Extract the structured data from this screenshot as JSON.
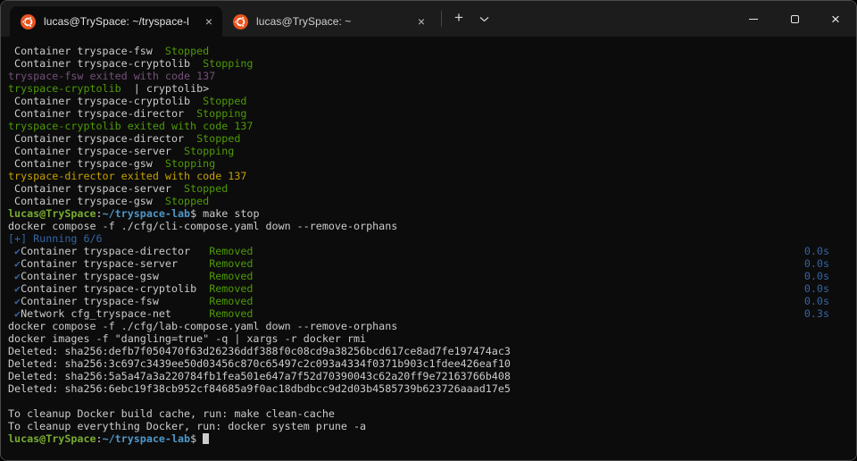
{
  "window": {
    "tabs": [
      {
        "title": "lucas@TrySpace: ~/tryspace-l",
        "active": true
      },
      {
        "title": "lucas@TrySpace: ~",
        "active": false
      }
    ],
    "new_tab_glyph": "+",
    "dropdown_glyph": "⌄",
    "tab_close_glyph": "×",
    "close_glyph": "×"
  },
  "colors": {
    "fg": "#cccccc",
    "green": "#4e9a06",
    "purple": "#75507b",
    "yellow": "#c4a000",
    "blue": "#3465a4",
    "promptUser": "#78ac30",
    "promptPath": "#4e97c9",
    "background": "#0c0c0c",
    "titlebar": "#1c1c1c",
    "ubuntuOrange": "#e95420"
  },
  "terminal": {
    "lines": [
      {
        "s": [
          {
            "t": " Container tryspace-fsw  ",
            "c": "fg"
          },
          {
            "t": "Stopped",
            "c": "green"
          }
        ]
      },
      {
        "s": [
          {
            "t": " Container tryspace-cryptolib  ",
            "c": "fg"
          },
          {
            "t": "Stopping",
            "c": "green"
          }
        ]
      },
      {
        "s": [
          {
            "t": "tryspace-fsw exited with code 137",
            "c": "purple"
          }
        ]
      },
      {
        "s": [
          {
            "t": "tryspace-cryptolib ",
            "c": "green"
          },
          {
            "t": " | cryptolib>",
            "c": "fg"
          }
        ]
      },
      {
        "s": [
          {
            "t": " Container tryspace-cryptolib  ",
            "c": "fg"
          },
          {
            "t": "Stopped",
            "c": "green"
          }
        ]
      },
      {
        "s": [
          {
            "t": " Container tryspace-director  ",
            "c": "fg"
          },
          {
            "t": "Stopping",
            "c": "green"
          }
        ]
      },
      {
        "s": [
          {
            "t": "tryspace-cryptolib exited with code 137",
            "c": "green"
          }
        ]
      },
      {
        "s": [
          {
            "t": " Container tryspace-director  ",
            "c": "fg"
          },
          {
            "t": "Stopped",
            "c": "green"
          }
        ]
      },
      {
        "s": [
          {
            "t": " Container tryspace-server  ",
            "c": "fg"
          },
          {
            "t": "Stopping",
            "c": "green"
          }
        ]
      },
      {
        "s": [
          {
            "t": " Container tryspace-gsw  ",
            "c": "fg"
          },
          {
            "t": "Stopping",
            "c": "green"
          }
        ]
      },
      {
        "s": [
          {
            "t": "tryspace-director exited with code 137",
            "c": "yellow"
          }
        ]
      },
      {
        "s": [
          {
            "t": " Container tryspace-server  ",
            "c": "fg"
          },
          {
            "t": "Stopped",
            "c": "green"
          }
        ]
      },
      {
        "s": [
          {
            "t": " Container tryspace-gsw  ",
            "c": "fg"
          },
          {
            "t": "Stopped",
            "c": "green"
          }
        ]
      },
      {
        "s": [
          {
            "t": "lucas@TrySpace",
            "c": "promptUser",
            "b": true
          },
          {
            "t": ":",
            "c": "fg"
          },
          {
            "t": "~/tryspace-lab",
            "c": "promptPath",
            "b": true
          },
          {
            "t": "$ ",
            "c": "fg"
          },
          {
            "t": "make stop",
            "c": "fg"
          }
        ]
      },
      {
        "s": [
          {
            "t": "docker compose -f ./cfg/cli-compose.yaml down --remove-orphans",
            "c": "fg"
          }
        ]
      },
      {
        "s": [
          {
            "t": "[+] Running 6/6",
            "c": "blue"
          }
        ]
      },
      {
        "s": [
          {
            "t": " ✔",
            "c": "blue"
          },
          {
            "t": "Container tryspace-director   ",
            "c": "fg"
          },
          {
            "t": "Removed",
            "c": "green"
          }
        ],
        "time": "0.0s"
      },
      {
        "s": [
          {
            "t": " ✔",
            "c": "blue"
          },
          {
            "t": "Container tryspace-server     ",
            "c": "fg"
          },
          {
            "t": "Removed",
            "c": "green"
          }
        ],
        "time": "0.0s"
      },
      {
        "s": [
          {
            "t": " ✔",
            "c": "blue"
          },
          {
            "t": "Container tryspace-gsw        ",
            "c": "fg"
          },
          {
            "t": "Removed",
            "c": "green"
          }
        ],
        "time": "0.0s"
      },
      {
        "s": [
          {
            "t": " ✔",
            "c": "blue"
          },
          {
            "t": "Container tryspace-cryptolib  ",
            "c": "fg"
          },
          {
            "t": "Removed",
            "c": "green"
          }
        ],
        "time": "0.0s"
      },
      {
        "s": [
          {
            "t": " ✔",
            "c": "blue"
          },
          {
            "t": "Container tryspace-fsw        ",
            "c": "fg"
          },
          {
            "t": "Removed",
            "c": "green"
          }
        ],
        "time": "0.0s"
      },
      {
        "s": [
          {
            "t": " ✔",
            "c": "blue"
          },
          {
            "t": "Network cfg_tryspace-net      ",
            "c": "fg"
          },
          {
            "t": "Removed",
            "c": "green"
          }
        ],
        "time": "0.3s"
      },
      {
        "s": [
          {
            "t": "docker compose -f ./cfg/lab-compose.yaml down --remove-orphans",
            "c": "fg"
          }
        ]
      },
      {
        "s": [
          {
            "t": "docker images -f \"dangling=true\" -q | xargs -r docker rmi",
            "c": "fg"
          }
        ]
      },
      {
        "s": [
          {
            "t": "Deleted: sha256:defb7f050470f63d26236ddf388f0c08cd9a38256bcd617ce8ad7fe197474ac3",
            "c": "fg"
          }
        ]
      },
      {
        "s": [
          {
            "t": "Deleted: sha256:3c697c3439ee50d03456c870c65497c2c093a4334f0371b903c1fdee426eaf10",
            "c": "fg"
          }
        ]
      },
      {
        "s": [
          {
            "t": "Deleted: sha256:5a5a47a3a220784fb1fea501e647a7f52d70390043c62a20ff9e72163766b408",
            "c": "fg"
          }
        ]
      },
      {
        "s": [
          {
            "t": "Deleted: sha256:6ebc19f38cb952cf84685a9f0ac18dbdbcc9d2d03b4585739b623726aaad17e5",
            "c": "fg"
          }
        ]
      },
      {
        "s": []
      },
      {
        "s": [
          {
            "t": "To cleanup Docker build cache, run: make clean-cache",
            "c": "fg"
          }
        ]
      },
      {
        "s": [
          {
            "t": "To cleanup everything Docker, run: docker system prune -a",
            "c": "fg"
          }
        ]
      },
      {
        "s": [
          {
            "t": "lucas@TrySpace",
            "c": "promptUser",
            "b": true
          },
          {
            "t": ":",
            "c": "fg"
          },
          {
            "t": "~/tryspace-lab",
            "c": "promptPath",
            "b": true
          },
          {
            "t": "$ ",
            "c": "fg"
          }
        ],
        "cursor": true
      }
    ]
  }
}
